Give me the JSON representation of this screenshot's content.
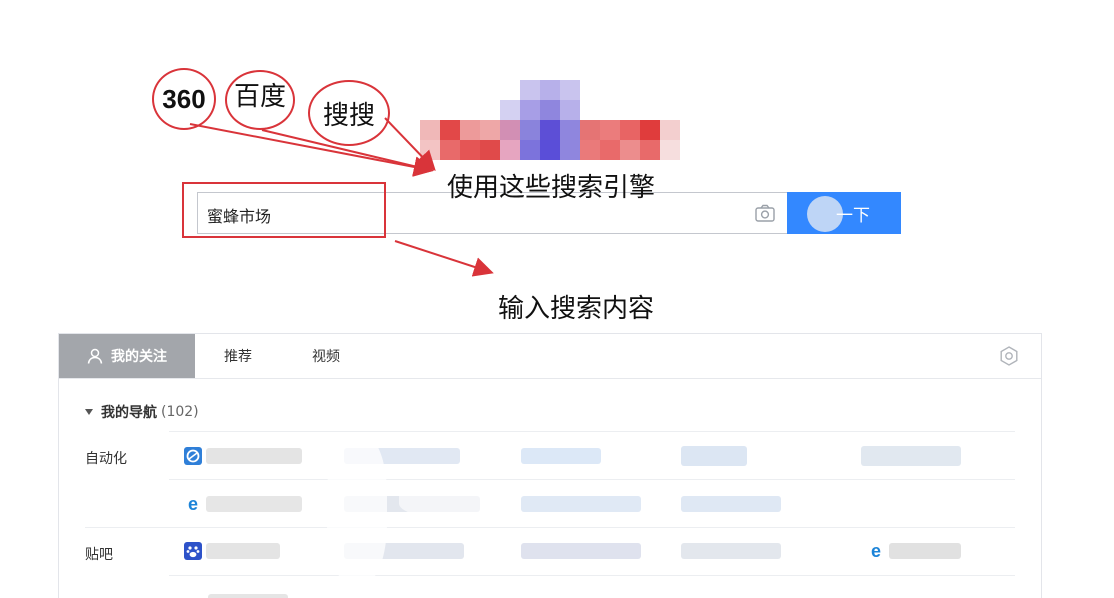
{
  "annotations": {
    "engines": [
      "360",
      "百度",
      "搜搜"
    ],
    "engines_caption": "使用这些搜索引擎",
    "input_caption": "输入搜索内容",
    "annotation_color": "#d9343a"
  },
  "search": {
    "query": "蜜蜂市场",
    "button_label": "一下",
    "button_color": "#3388ff",
    "camera_icon": "camera-icon"
  },
  "tabs": [
    {
      "label": "我的关注",
      "active": true,
      "icon": "user-icon"
    },
    {
      "label": "推荐",
      "active": false
    },
    {
      "label": "视频",
      "active": false
    }
  ],
  "settings_icon": "gear-icon",
  "nav": {
    "title": "我的导航",
    "count": "(102)",
    "categories": [
      {
        "label": "自动化"
      },
      {
        "label": "贴吧"
      }
    ]
  },
  "links": [
    {
      "icon": "site-icon"
    },
    {
      "icon": "ie-icon"
    },
    {
      "icon": "baidu-paw-icon"
    },
    {
      "icon": "ie-icon"
    }
  ]
}
